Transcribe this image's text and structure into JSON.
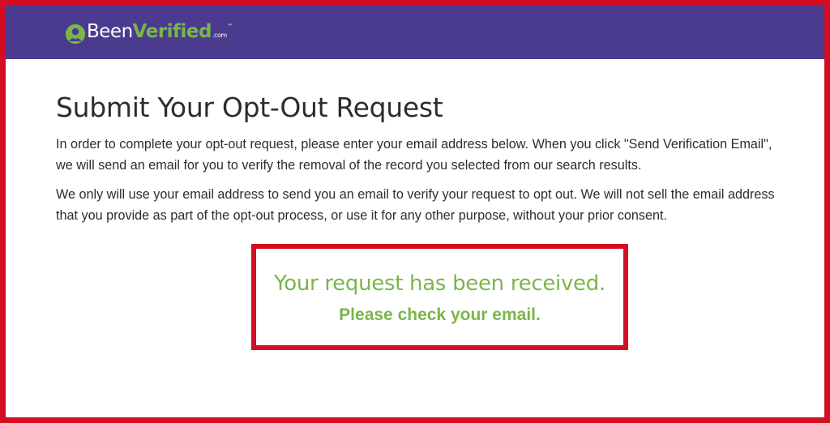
{
  "header": {
    "logo": {
      "word_one": "Been",
      "word_two": "Verified",
      "suffix": ".com",
      "trademark": "™"
    },
    "background_color": "#4a3b8f",
    "brand_green": "#7ab648"
  },
  "main": {
    "title": "Submit Your Opt-Out Request",
    "paragraph_1_line_1": "In order to complete your opt-out request, please enter your email address below. When you click \"Send Verification Email\",",
    "paragraph_1_line_2": "we will send an email for you to verify the removal of the record you selected from our search results.",
    "paragraph_2_line_1": "We only will use your email address to send you an email to verify your request to opt out. We will not sell the email address",
    "paragraph_2_line_2": "that you provide as part of the opt-out process, or use it for any other purpose, without your prior consent."
  },
  "notice": {
    "headline": "Your request has been received.",
    "subline": "Please check your email.",
    "highlight_color": "#d40e22"
  }
}
